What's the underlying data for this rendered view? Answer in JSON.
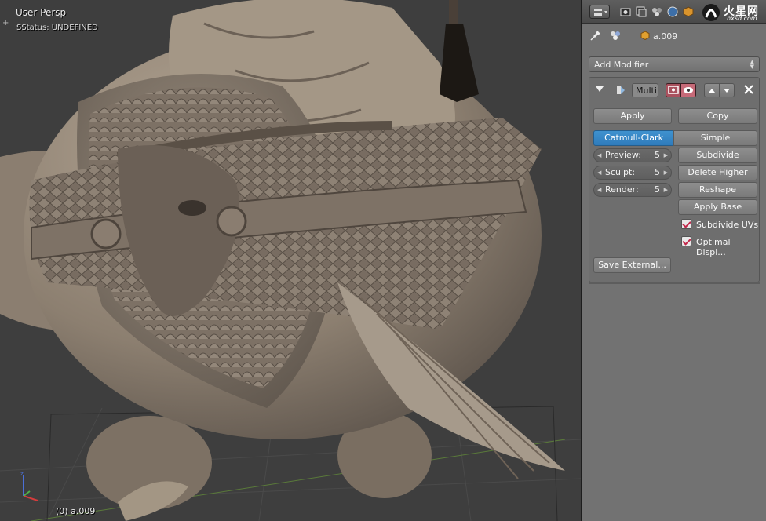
{
  "viewport": {
    "title": "User Persp",
    "status": "SStatus: UNDEFINED",
    "corner_plus": "+",
    "object_label": "(0) a.009"
  },
  "header": {
    "editor_type_icon": "editor-type-icon",
    "context_icons": [
      "render-icon",
      "render-layers-icon",
      "scene-icon",
      "world-icon",
      "object-icon",
      "constraints-icon"
    ],
    "watermark": {
      "title": "火星网",
      "subtitle": "hxsd.com"
    }
  },
  "context": {
    "pin_icon": "pin-icon",
    "modifier_icon": "modifier-wrench-icon",
    "object_icon": "object-cube-icon",
    "object_name": "a.009"
  },
  "add_modifier": {
    "label": "Add Modifier"
  },
  "modifier": {
    "name": "Multi",
    "apply_label": "Apply",
    "copy_label": "Copy",
    "subdivision_types": [
      "Catmull-Clark",
      "Simple"
    ],
    "selected_type": "Catmull-Clark",
    "levels": [
      {
        "label": "Preview:",
        "value": "5"
      },
      {
        "label": "Sculpt:",
        "value": "5"
      },
      {
        "label": "Render:",
        "value": "5"
      }
    ],
    "actions": [
      "Subdivide",
      "Delete Higher",
      "Reshape",
      "Apply Base"
    ],
    "checkboxes": [
      {
        "label": "Subdivide UVs",
        "checked": true
      },
      {
        "label": "Optimal Displ...",
        "checked": true
      }
    ],
    "save_external_label": "Save External..."
  },
  "colors": {
    "panel_bg": "#727272",
    "active_button": "#3a8ccb",
    "toggle_red": "#c66a78",
    "checkmark": "#c2274a"
  }
}
